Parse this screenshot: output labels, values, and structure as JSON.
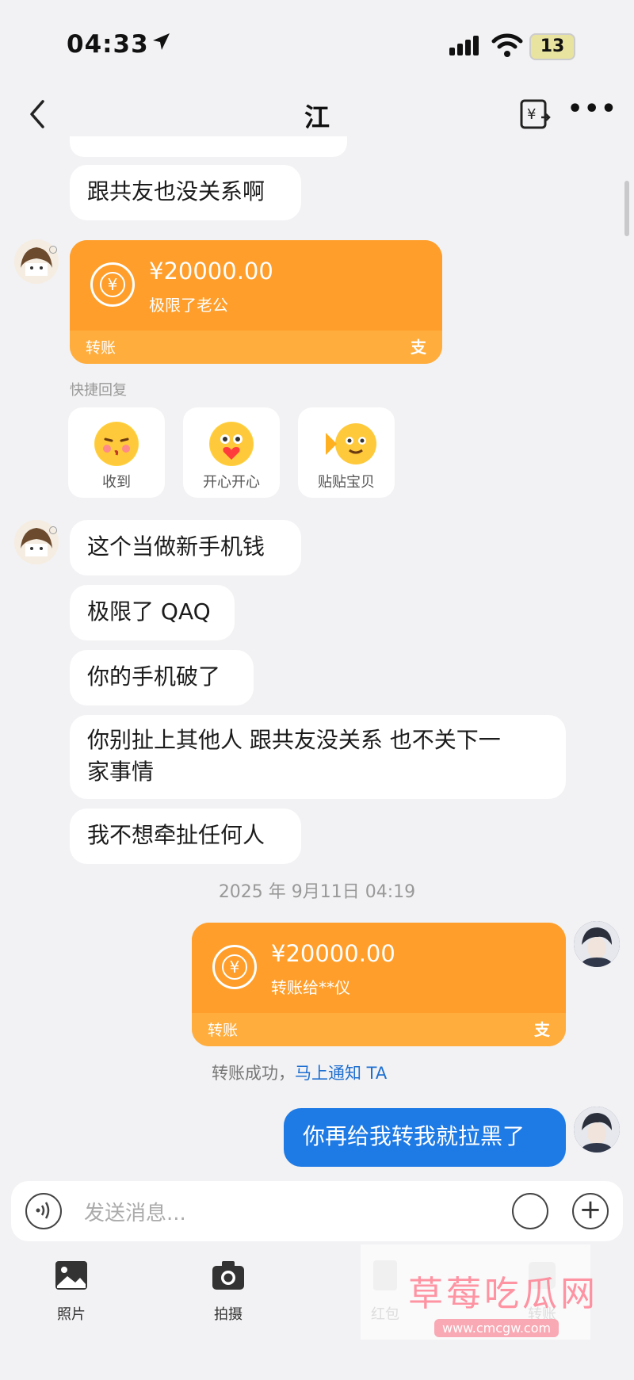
{
  "status_bar": {
    "time": "04:33",
    "battery": "13"
  },
  "header": {
    "title": "江"
  },
  "messages": {
    "partial_top": "",
    "m1": "跟共友也没关系啊",
    "m2": "这个当做新手机钱",
    "m3": "极限了 QAQ",
    "m4": "你的手机破了",
    "m5_line1": "你别扯上其他人 跟共友没关系 也不关下一",
    "m5_line2": "家事情",
    "m6": "我不想牵扯任何人",
    "m7_me": "你再给我转我就拉黑了"
  },
  "transfer_received": {
    "amount": "¥20000.00",
    "memo": "极限了老公",
    "label": "转账",
    "alipay_icon": "支"
  },
  "quick_reply": {
    "title": "快捷回复",
    "items": [
      {
        "label": "收到",
        "icon": "kiss-emoji-icon"
      },
      {
        "label": "开心开心",
        "icon": "heart-emoji-icon"
      },
      {
        "label": "贴贴宝贝",
        "icon": "hug-emoji-icon"
      }
    ]
  },
  "timestamp": "2025 年 9月11日 04:19",
  "transfer_sent": {
    "amount": "¥20000.00",
    "memo": "转账给**仪",
    "label": "转账",
    "alipay_icon": "支"
  },
  "transfer_status": {
    "text": "转账成功，",
    "link": "马上通知 TA"
  },
  "input": {
    "placeholder": "发送消息..."
  },
  "toolbar": {
    "items": [
      {
        "label": "照片"
      },
      {
        "label": "拍摄"
      },
      {
        "label": "红包"
      },
      {
        "label": "转账"
      }
    ]
  },
  "watermark": {
    "text": "草莓吃瓜网",
    "url": "www.cmcgw.com"
  },
  "colors": {
    "accent_orange": "#ff9e2a",
    "bubble_blue": "#1e7ae5",
    "link_blue": "#1e6fd0"
  }
}
